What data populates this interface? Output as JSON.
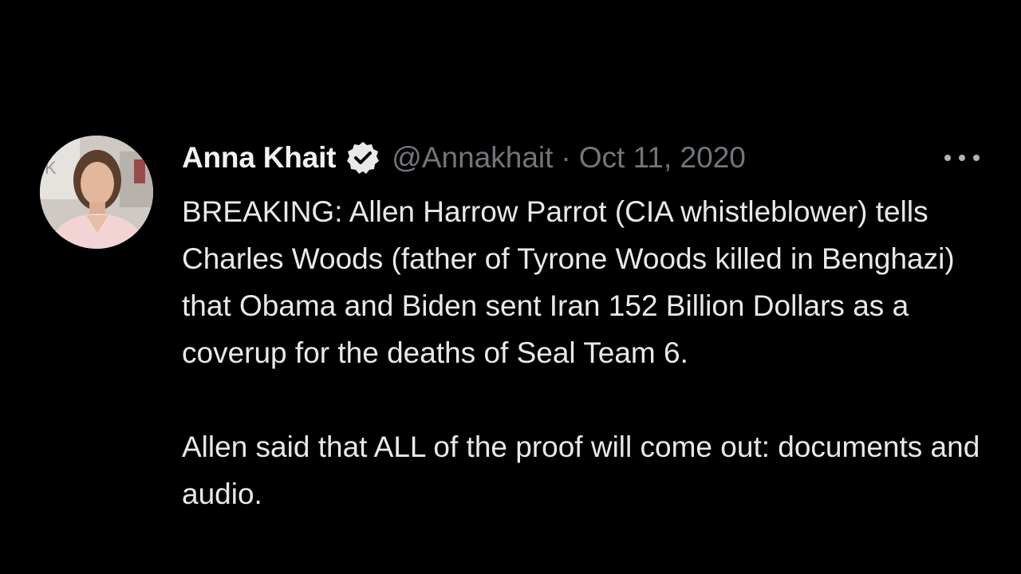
{
  "tweet": {
    "author": {
      "display_name": "Anna Khait",
      "verified_icon": "verified-badge-icon",
      "handle": "@Annakhait",
      "separator": "·",
      "date": "Oct 11, 2020"
    },
    "more_icon": "more-options-icon",
    "text": {
      "paragraphs": [
        "BREAKING: Allen Harrow Parrot (CIA whistleblower) tells Charles Woods (father of Tyrone Woods killed in Benghazi) that Obama and Biden sent Iran 152 Billion Dollars as a coverup for the deaths of Seal Team 6.",
        "Allen said that ALL of the proof will come out: documents and audio."
      ]
    }
  },
  "colors": {
    "background": "#000000",
    "text_primary": "#e7e9ea",
    "text_secondary": "#71767b"
  }
}
